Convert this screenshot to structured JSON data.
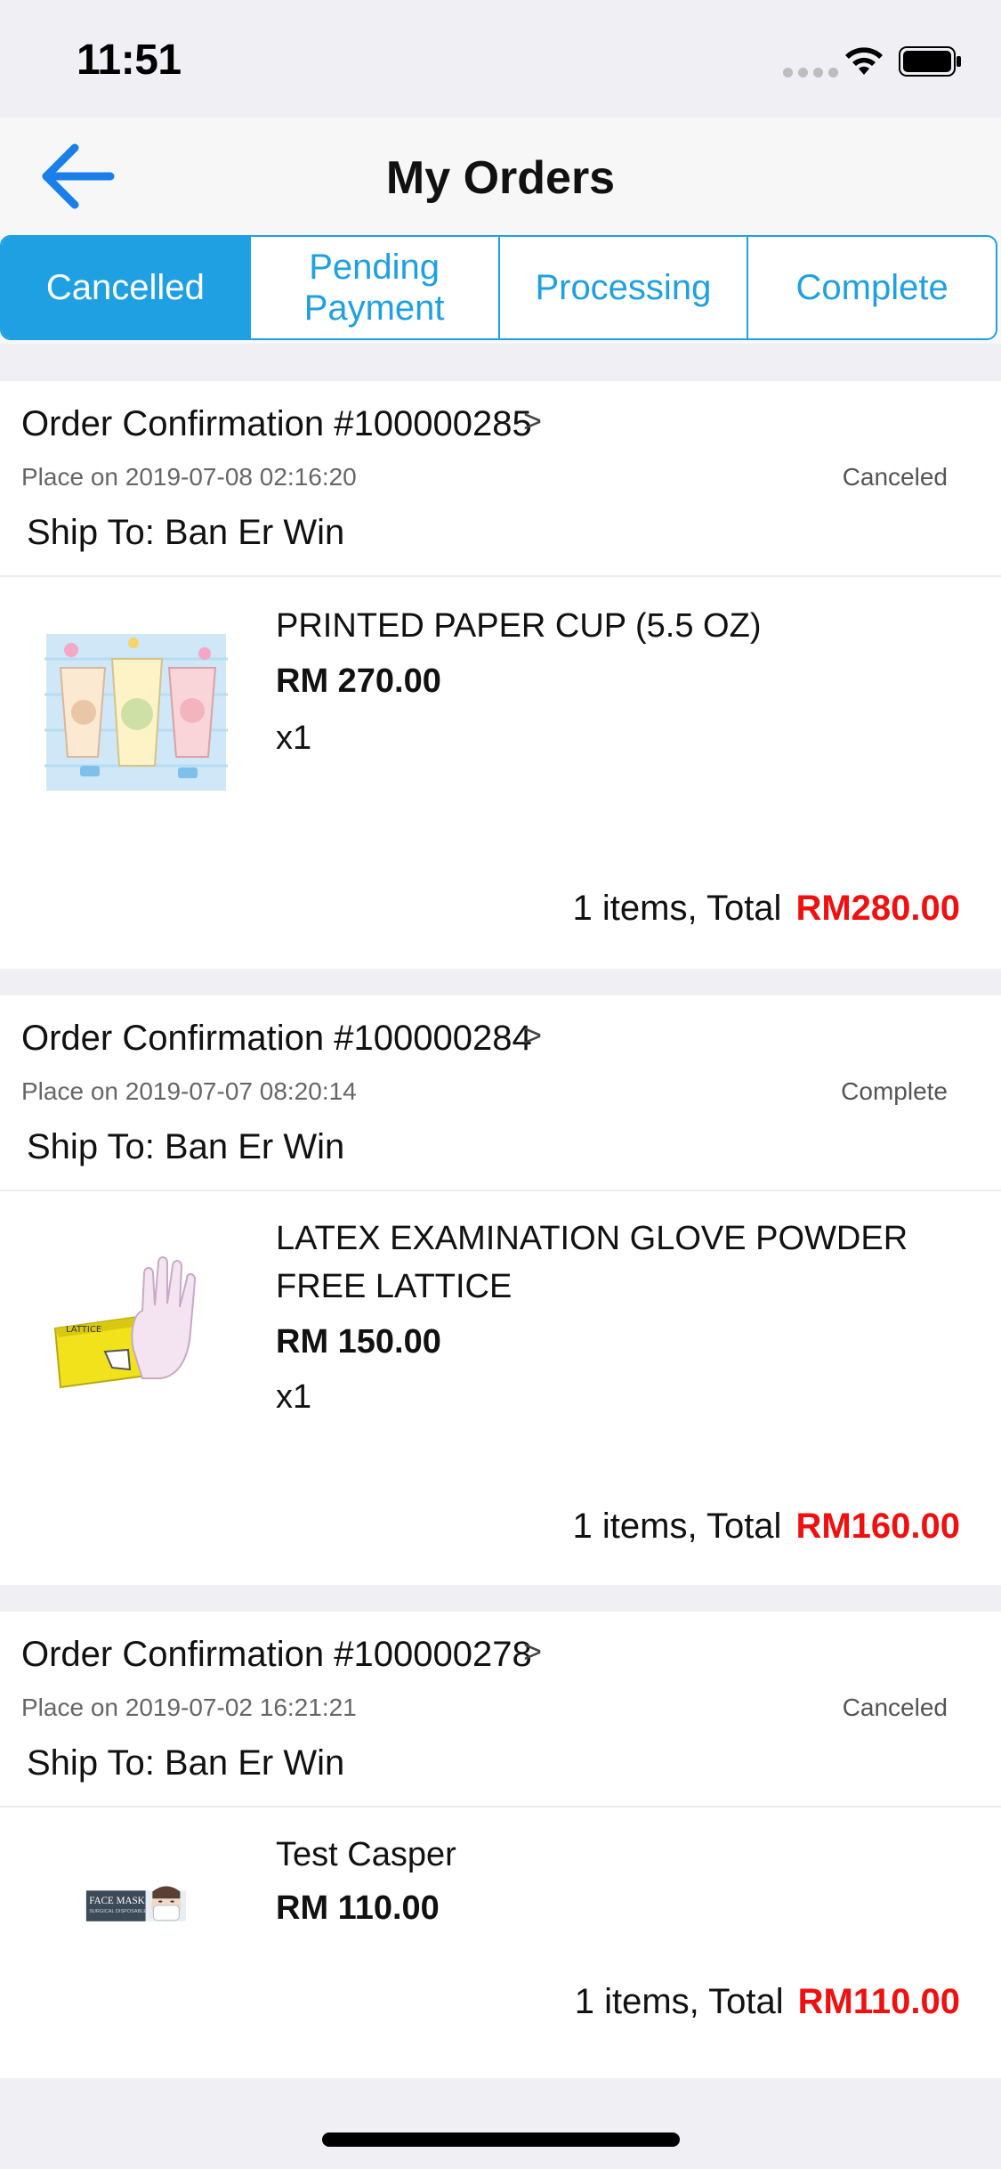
{
  "status_bar": {
    "time": "11:51"
  },
  "nav": {
    "title": "My Orders",
    "back_icon": "back-arrow-icon",
    "accent_color": "#1fa0e3"
  },
  "tabs": [
    {
      "label": "Cancelled",
      "active": true
    },
    {
      "label": "Pending\nPayment",
      "active": false
    },
    {
      "label": "Processing",
      "active": false
    },
    {
      "label": "Complete",
      "active": false
    }
  ],
  "orders": [
    {
      "title": "Order Confirmation #100000285",
      "chevron": ">",
      "date": "Place on 2019-07-08 02:16:20",
      "status": "Canceled",
      "ship_to": "Ship To:  Ban Er Win",
      "item": {
        "name": "PRINTED PAPER CUP (5.5 OZ)",
        "price": "RM 270.00",
        "qty": "x1",
        "thumb_icon": "paper-cups-image"
      },
      "total_label": "1 items, Total",
      "total_amount": "RM280.00"
    },
    {
      "title": "Order Confirmation #100000284",
      "chevron": ">",
      "date": "Place on 2019-07-07 08:20:14",
      "status": "Complete",
      "ship_to": "Ship To:  Ban Er Win",
      "item": {
        "name": "LATEX EXAMINATION GLOVE POWDER FREE LATTICE",
        "price": "RM 150.00",
        "qty": "x1",
        "thumb_icon": "latex-gloves-image"
      },
      "total_label": "1 items, Total",
      "total_amount": "RM160.00"
    },
    {
      "title": "Order Confirmation #100000278",
      "chevron": ">",
      "date": "Place on 2019-07-02 16:21:21",
      "status": "Canceled",
      "ship_to": "Ship To:  Ban Er Win",
      "item": {
        "name": "Test Casper",
        "price": "RM 110.00",
        "thumb_icon": "face-mask-image"
      },
      "total_label": "1 items, Total",
      "total_amount": "RM110.00"
    }
  ],
  "colors": {
    "total_red": "#ef1010",
    "background": "#efeff4"
  }
}
